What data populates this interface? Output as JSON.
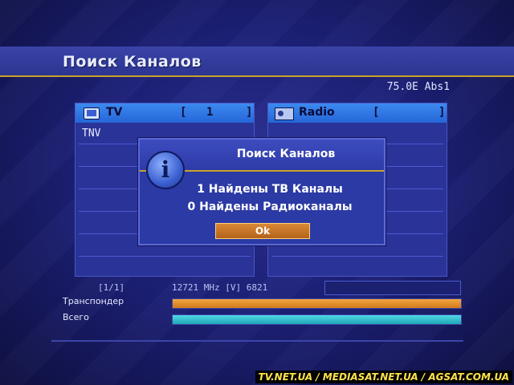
{
  "header": {
    "title": "Поиск Каналов",
    "satellite": "75.0E Abs1"
  },
  "tv_panel": {
    "label": "TV",
    "bracket_left": "[",
    "count": "1",
    "bracket_right": "]",
    "channels": [
      "TNV"
    ]
  },
  "radio_panel": {
    "label": "Radio",
    "bracket_left": "[",
    "count": "",
    "bracket_right": "]"
  },
  "status": {
    "page": "[1/1]",
    "frequency": "12721 MHz [V] 6821",
    "transponder_label": "Транспондер",
    "transponder_progress": 1.0,
    "total_label": "Всего",
    "total_progress": 1.0
  },
  "dialog": {
    "title": "Поиск Каналов",
    "line1": "1 Найдены ТВ Каналы",
    "line2": "0 Найдены Радиоканалы",
    "ok_label": "Ok"
  },
  "colors": {
    "progress_orange": "#e0902e",
    "progress_cyan": "#33c3d2",
    "accent_gold": "#c9a22a",
    "panel_header": "#2466d8"
  },
  "icons": {
    "tv": "tv-icon",
    "radio": "radio-icon",
    "dialog": "info-icon"
  },
  "watermark": "TV.NET.UA / MEDIASAT.NET.UA / AGSAT.COM.UA"
}
